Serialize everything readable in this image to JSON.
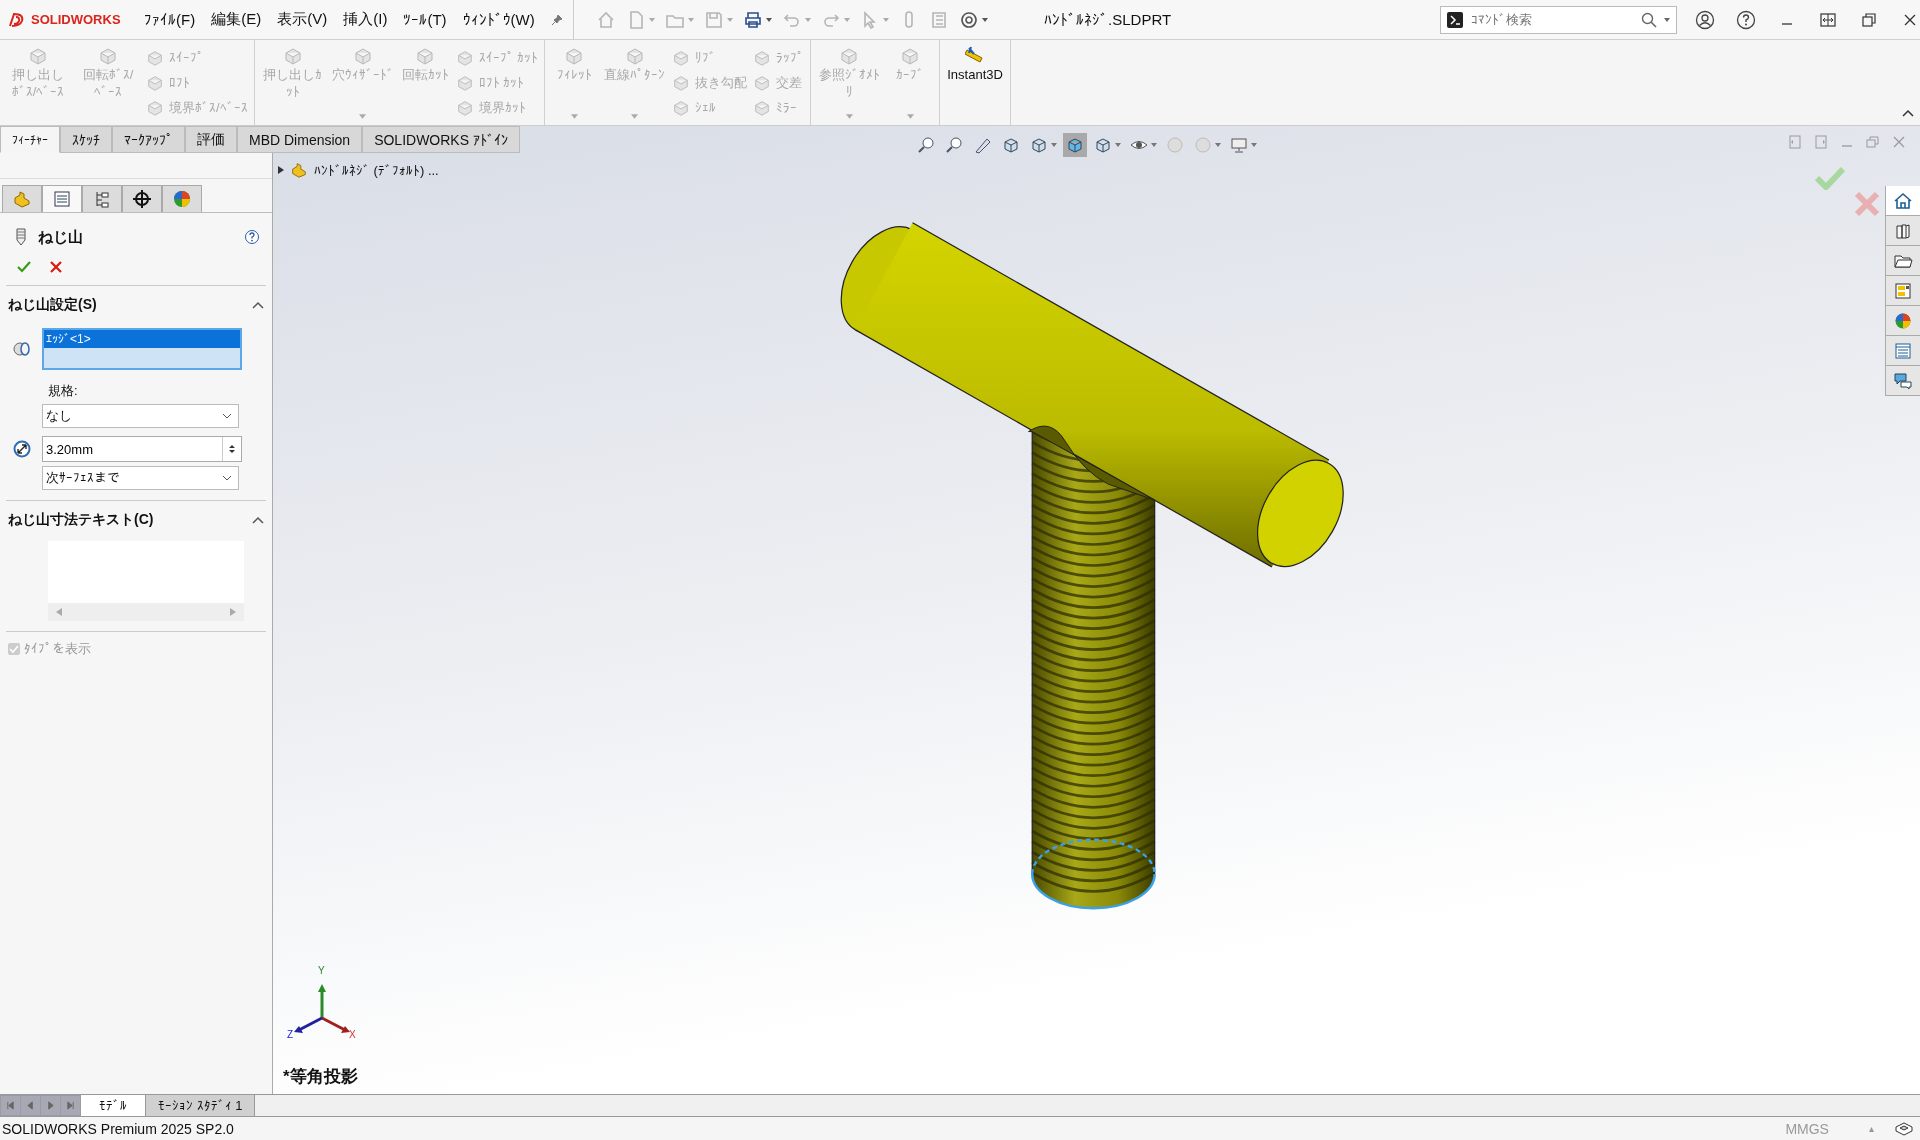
{
  "app": {
    "logo": "SOLIDWORKS",
    "title": "ﾊﾝﾄﾞﾙﾈｼﾞ.SLDPRT",
    "search": {
      "placeholder": "ｺﾏﾝﾄﾞ検索"
    },
    "menus": [
      {
        "label": "ﾌｧｲﾙ(F)"
      },
      {
        "label": "編集(E)"
      },
      {
        "label": "表示(V)"
      },
      {
        "label": "挿入(I)"
      },
      {
        "label": "ﾂｰﾙ(T)"
      },
      {
        "label": "ｳｨﾝﾄﾞｳ(W)"
      }
    ],
    "quick_access": [
      {
        "disabled": true,
        "menu": false
      },
      {
        "disabled": true,
        "menu": true
      },
      {
        "disabled": true,
        "menu": true
      },
      {
        "disabled": true,
        "menu": true
      },
      {
        "disabled": false,
        "menu": true
      },
      {
        "disabled": true,
        "menu": true
      },
      {
        "disabled": true,
        "menu": true
      },
      {
        "disabled": true,
        "menu": true
      },
      {
        "disabled": true,
        "menu": false
      },
      {
        "disabled": true,
        "menu": false
      },
      {
        "disabled": false,
        "menu": true
      }
    ]
  },
  "ribbon": {
    "groups": [
      {
        "items": [
          {
            "kind": "large",
            "label": "押し出しﾎﾞｽ/ﾍﾞｰｽ",
            "disabled": true,
            "menu": false
          },
          {
            "kind": "large",
            "label": "回転ﾎﾞｽ/ﾍﾞｰｽ",
            "disabled": true,
            "menu": false
          },
          {
            "kind": "stack",
            "buttons": [
              {
                "label": "ｽｲｰﾌﾟ",
                "disabled": true
              },
              {
                "label": "ﾛﾌﾄ",
                "disabled": true
              },
              {
                "label": "境界ﾎﾞｽ/ﾍﾞｰｽ",
                "disabled": true
              }
            ]
          }
        ]
      },
      {
        "items": [
          {
            "kind": "large",
            "label": "押し出しｶｯﾄ",
            "disabled": true,
            "menu": false
          },
          {
            "kind": "large",
            "label": "穴ｳｨｻﾞｰﾄﾞ",
            "disabled": true,
            "menu": true
          },
          {
            "kind": "large",
            "label": "回転ｶｯﾄ",
            "disabled": true,
            "menu": false
          },
          {
            "kind": "stack",
            "buttons": [
              {
                "label": "ｽｲｰﾌﾟ ｶｯﾄ",
                "disabled": true
              },
              {
                "label": "ﾛﾌﾄ ｶｯﾄ",
                "disabled": true
              },
              {
                "label": "境界ｶｯﾄ",
                "disabled": true
              }
            ]
          }
        ]
      },
      {
        "items": [
          {
            "kind": "large",
            "label": "ﾌｨﾚｯﾄ",
            "disabled": true,
            "menu": true
          },
          {
            "kind": "large",
            "label": "直線ﾊﾟﾀｰﾝ",
            "disabled": true,
            "menu": true
          },
          {
            "kind": "stack",
            "buttons": [
              {
                "label": "ﾘﾌﾞ",
                "disabled": true
              },
              {
                "label": "抜き勾配",
                "disabled": true
              },
              {
                "label": "ｼｪﾙ",
                "disabled": true
              }
            ]
          },
          {
            "kind": "stack",
            "buttons": [
              {
                "label": "ﾗｯﾌﾟ",
                "disabled": true
              },
              {
                "label": "交差",
                "disabled": true
              },
              {
                "label": "ﾐﾗｰ",
                "disabled": true
              }
            ]
          }
        ]
      },
      {
        "items": [
          {
            "kind": "large",
            "label": "参照ｼﾞｵﾒﾄﾘ",
            "disabled": true,
            "menu": true
          },
          {
            "kind": "large",
            "label": "ｶｰﾌﾞ",
            "disabled": true,
            "menu": true
          }
        ]
      },
      {
        "items": [
          {
            "kind": "large",
            "label": "Instant3D",
            "disabled": false,
            "menu": false
          }
        ]
      }
    ],
    "tabs": [
      {
        "label": "ﾌｨｰﾁｬｰ",
        "selected": true
      },
      {
        "label": "ｽｹｯﾁ",
        "selected": false
      },
      {
        "label": "ﾏｰｸｱｯﾌﾟ",
        "selected": false
      },
      {
        "label": "評価",
        "selected": false
      },
      {
        "label": "MBD Dimension",
        "selected": false
      },
      {
        "label": "SOLIDWORKS ｱﾄﾞｲﾝ",
        "selected": false
      }
    ]
  },
  "panel": {
    "tabs": [
      {
        "selected": false
      },
      {
        "selected": true
      },
      {
        "selected": false
      },
      {
        "selected": false
      },
      {
        "selected": false
      }
    ],
    "title": "ねじ山",
    "sections": [
      {
        "kind": "settings",
        "title": "ねじ山設定(S)",
        "expanded": true,
        "selection": [
          {
            "label": "ｴｯｼﾞ<1>",
            "selected": true
          }
        ],
        "standard_label": "規格:",
        "standard": "なし",
        "diameter": "3.20mm",
        "end_condition": "次ｻｰﾌｪｽまで"
      },
      {
        "kind": "text",
        "title": "ねじ山寸法テキスト(C)",
        "expanded": true
      }
    ],
    "show_type": {
      "label": "ﾀｲﾌﾟを表示",
      "checked": true,
      "disabled": true
    }
  },
  "viewport": {
    "breadcrumb": "ﾊﾝﾄﾞﾙﾈｼﾞ (ﾃﾞﾌｫﾙﾄ) ...",
    "view_name": "*等角投影",
    "triad": {
      "x": "X",
      "y": "Y",
      "z": "Z"
    },
    "view_tools": [
      {
        "selected": false,
        "menu": false
      },
      {
        "selected": false,
        "menu": false
      },
      {
        "selected": false,
        "menu": false
      },
      {
        "selected": false,
        "menu": false
      },
      {
        "selected": false,
        "menu": true
      },
      {
        "selected": true,
        "menu": false
      },
      {
        "selected": false,
        "menu": true
      },
      {
        "selected": false,
        "menu": true
      },
      {
        "selected": false,
        "menu": false
      },
      {
        "selected": false,
        "menu": true
      },
      {
        "selected": false,
        "menu": true
      }
    ],
    "task_pane": [
      {
        "selected": true
      },
      {
        "selected": false
      },
      {
        "selected": false
      },
      {
        "selected": false
      },
      {
        "selected": false
      },
      {
        "selected": false
      },
      {
        "selected": false
      }
    ]
  },
  "bottom_tabs": [
    {
      "label": "ﾓﾃﾞﾙ",
      "selected": true
    },
    {
      "label": "ﾓｰｼｮﾝ ｽﾀﾃﾞｨ 1",
      "selected": false
    }
  ],
  "status_bar": {
    "product": "SOLIDWORKS Premium 2025 SP2.0",
    "units": "MMGS",
    "units_menu": "▴"
  }
}
